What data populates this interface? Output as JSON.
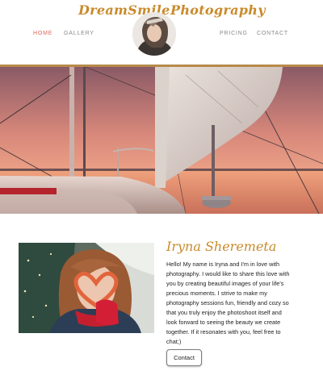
{
  "header": {
    "brand_left": "DreamSmile",
    "brand_right": "Photography",
    "nav": {
      "home": "HOME",
      "gallery": "GALLERY",
      "pricing": "PRICING",
      "contact": "CONTACT"
    },
    "active_nav": "home"
  },
  "about": {
    "name": "Iryna Sheremeta",
    "bio": "Hello! My name is Iryna and I'm in love with photography. I would like to share this love with you by creating beautiful images of your life's precious moments. I strive to make my photography sessions fun, friendly and cozy so that you truly enjoy the photoshoot itself and look forward to seeing the beauty we create together. If it resonates with you, feel free to chat;)",
    "button_label": "Contact"
  },
  "colors": {
    "brand": "#c98a2b",
    "active_nav": "#e0665a",
    "divider": "#b78a4a"
  }
}
